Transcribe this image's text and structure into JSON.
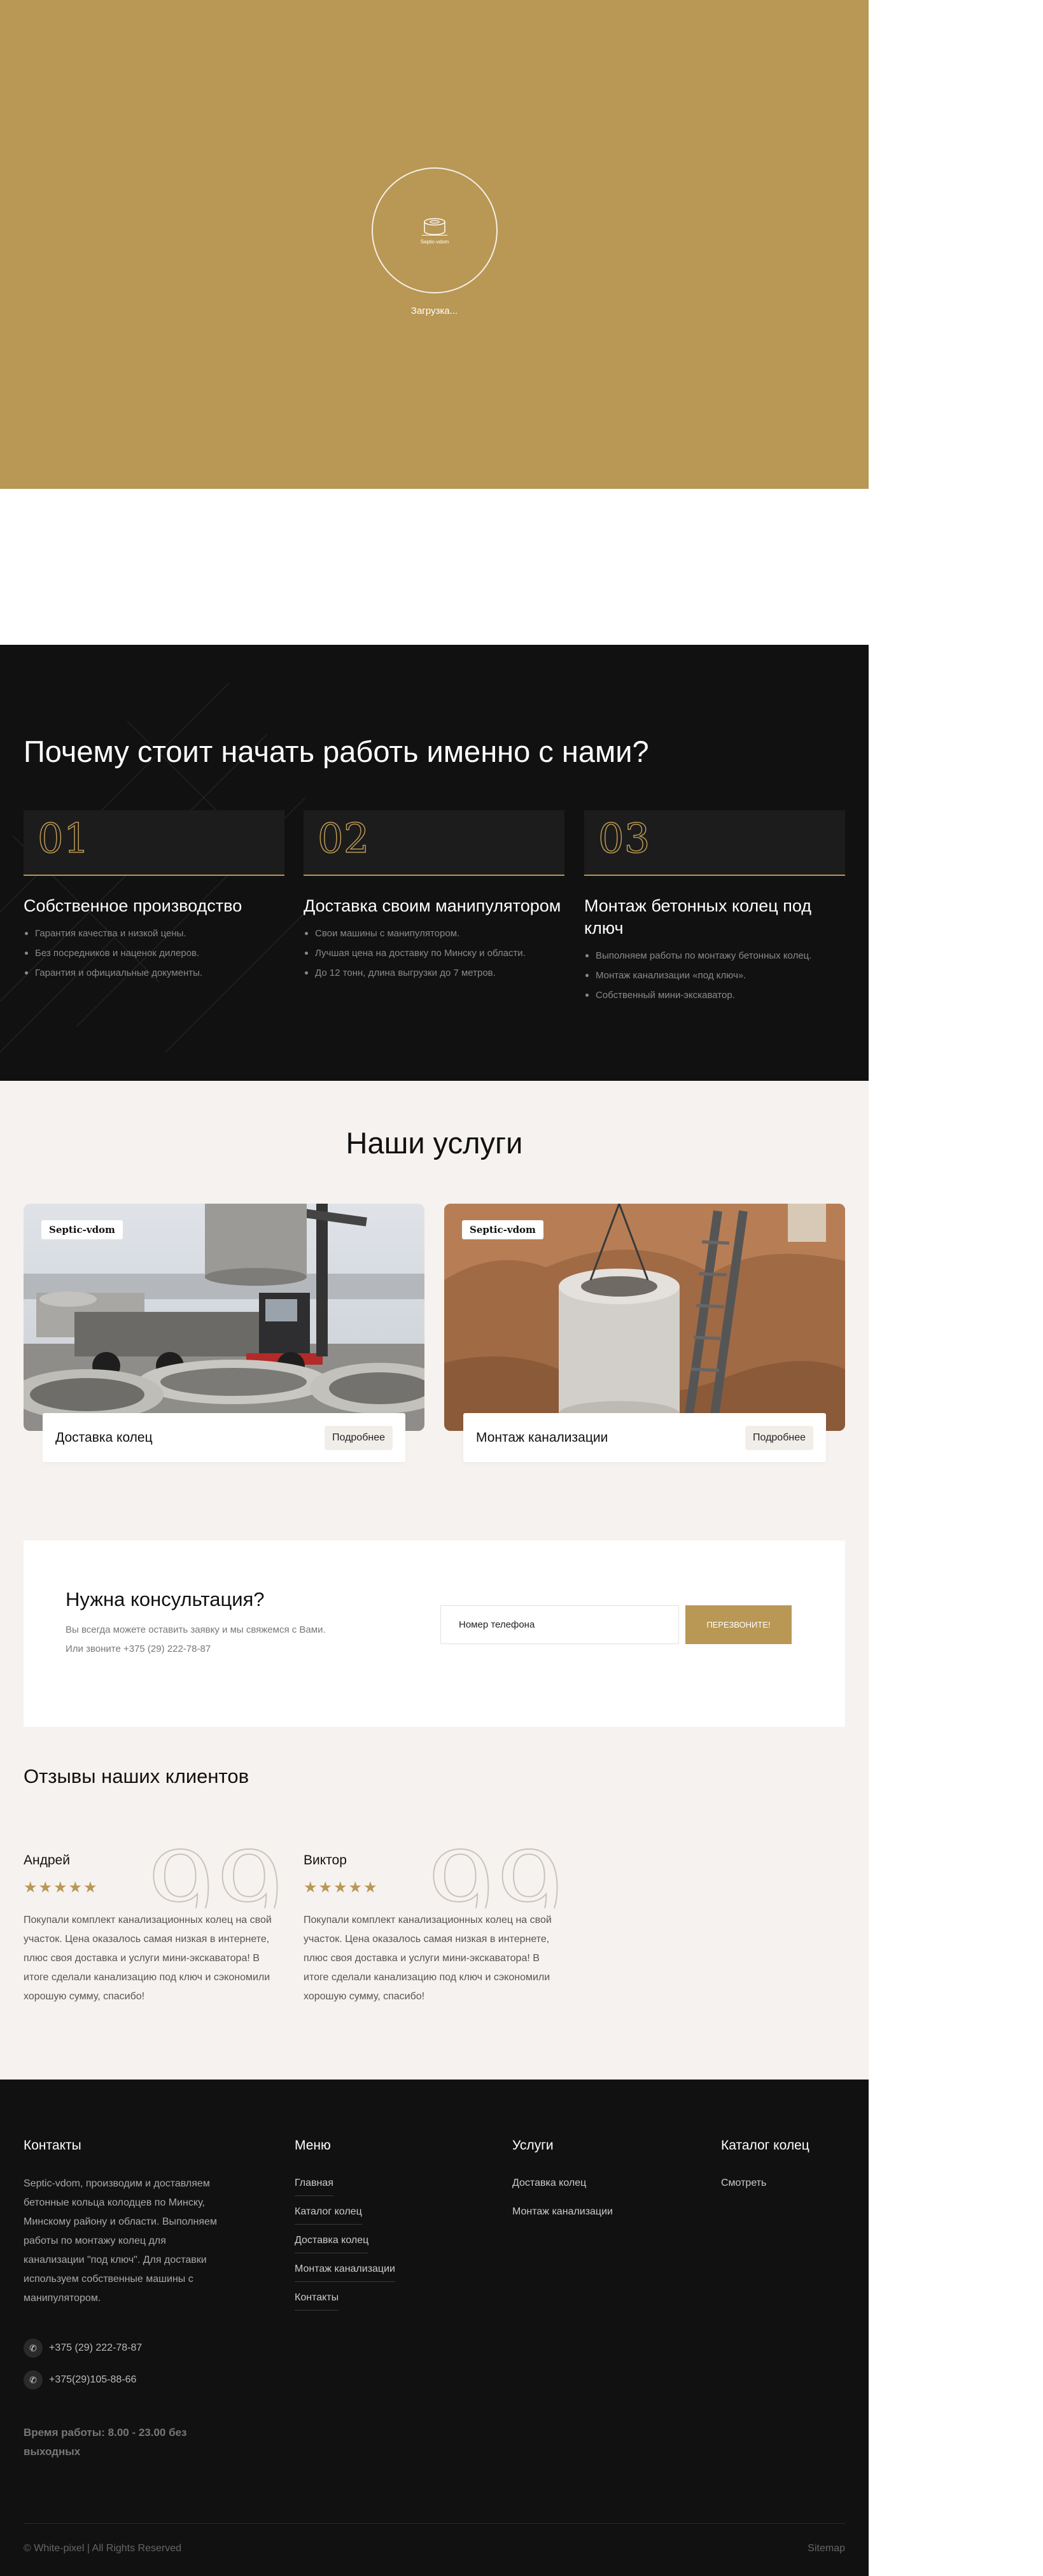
{
  "loader": {
    "logo_text": "Septic-vdom",
    "text": "Загрузка..."
  },
  "why": {
    "title": "Почему стоит начать работь именно с нами?",
    "columns": [
      {
        "number": "01",
        "heading": "Собственное производство",
        "items": [
          "Гарантия качества и низкой цены.",
          "Без посредников и наценок дилеров.",
          "Гарантия и официальные документы."
        ]
      },
      {
        "number": "02",
        "heading": "Доставка своим манипулятором",
        "items": [
          "Свои машины с манипулятором.",
          "Лучшая цена на доставку по Минску и области.",
          "До 12 тонн, длина выгрузки до 7 метров."
        ]
      },
      {
        "number": "03",
        "heading": "Монтаж бетонных колец под ключ",
        "items": [
          "Выполняем работы по монтажу бетонных колец.",
          "Монтаж канализации «под ключ».",
          "Собственный мини-экскаватор."
        ]
      }
    ]
  },
  "services": {
    "title": "Наши услуги",
    "cards": [
      {
        "badge": "Septic-vdom",
        "label": "Доставка колец",
        "button": "Подробнее"
      },
      {
        "badge": "Septic-vdom",
        "label": "Монтаж канализации",
        "button": "Подробнее"
      }
    ]
  },
  "consult": {
    "title": "Нужна консультация?",
    "line1": "Вы всегда можете оставить заявку и мы свяжемся с Вами.",
    "line2": "Или звоните +375 (29) 222-78-87",
    "phone_placeholder": "Номер телефона",
    "button": "ПЕРЕЗВОНИТЕ!"
  },
  "reviews": {
    "title": "Отзывы наших клиентов",
    "items": [
      {
        "name": "Андрей",
        "rating": 5,
        "stars": "★★★★★",
        "quote": "99",
        "text": "Покупали комплект канализационных колец на свой участок. Цена оказалось самая низкая в интернете, плюс своя доставка и услуги мини-экскаватора! В итоге сделали канализацию под ключ и сэкономили хорошую сумму, спасибо!"
      },
      {
        "name": "Виктор",
        "rating": 5,
        "stars": "★★★★★",
        "quote": "99",
        "text": "Покупали комплект канализационных колец на свой участок. Цена оказалось самая низкая в интернете, плюс своя доставка и услуги мини-экскаватора! В итоге сделали канализацию под ключ и сэкономили хорошую сумму, спасибо!"
      }
    ]
  },
  "footer": {
    "contacts": {
      "heading": "Контакты",
      "text": "Septic-vdom, производим и доставляем бетонные кольца колодцев по Минску, Минскому району и области. Выполняем работы по монтажу колец для канализации \"под ключ\". Для доставки используем собственные машины с манипулятором.",
      "phone1": "+375 (29) 222-78-87",
      "phone2": "+375(29)105-88-66",
      "hours": "Время работы: 8.00 - 23.00 без выходных"
    },
    "menu": {
      "heading": "Меню",
      "items": [
        "Главная",
        "Каталог колец",
        "Доставка колец",
        "Монтаж канализации",
        "Контакты"
      ]
    },
    "services": {
      "heading": "Услуги",
      "items": [
        "Доставка колец",
        "Монтаж канализации"
      ]
    },
    "catalog": {
      "heading": "Каталог колец",
      "items": [
        "Смотреть"
      ]
    },
    "copyright": "© White-pixel | All Rights Reserved",
    "sitemap": "Sitemap"
  },
  "colors": {
    "accent": "#b99755",
    "dark": "#111111",
    "light_bg": "#f6f2ef"
  }
}
